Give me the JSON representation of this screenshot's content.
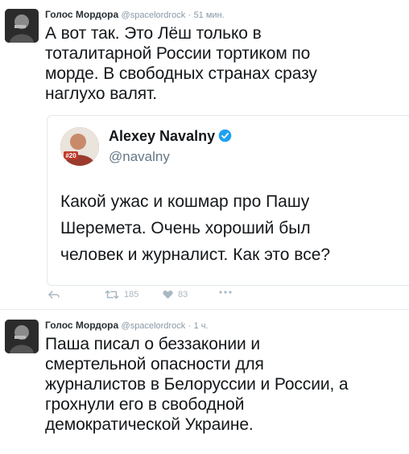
{
  "tweets": [
    {
      "author_name": "Голос Мордора",
      "handle": "@spacelordrock",
      "separator": "·",
      "time": "51 мин.",
      "text_lines": [
        "А вот так. Это Лёш только в",
        "тоталитарной России тортиком по",
        "морде. В свободных странах сразу",
        "наглухо валят."
      ],
      "quoted": {
        "author_name": "Alexey Navalny",
        "handle": "@navalny",
        "avatar_badge": "#20",
        "text_lines": [
          "Какой ужас и кошмар про Пашу",
          "Шеремета. Очень хороший был",
          "человек и журналист. Как это все?"
        ]
      },
      "actions": {
        "retweets": "185",
        "likes": "83"
      }
    },
    {
      "author_name": "Голос Мордора",
      "handle": "@spacelordrock",
      "separator": "·",
      "time": "1 ч.",
      "text_lines": [
        "Паша писал о беззаконии и",
        "смертельной опасности для",
        "журналистов в Белоруссии и России, а",
        "грохнули его в свободной",
        "демократической Украине."
      ]
    }
  ],
  "icons": {
    "reply": "reply-icon",
    "retweet": "retweet-icon",
    "like": "heart-icon",
    "more": "more-icon",
    "verified": "verified-badge-icon"
  },
  "colors": {
    "verified": "#1da1f2",
    "muted": "#8899a6",
    "action": "#aab8c2"
  }
}
